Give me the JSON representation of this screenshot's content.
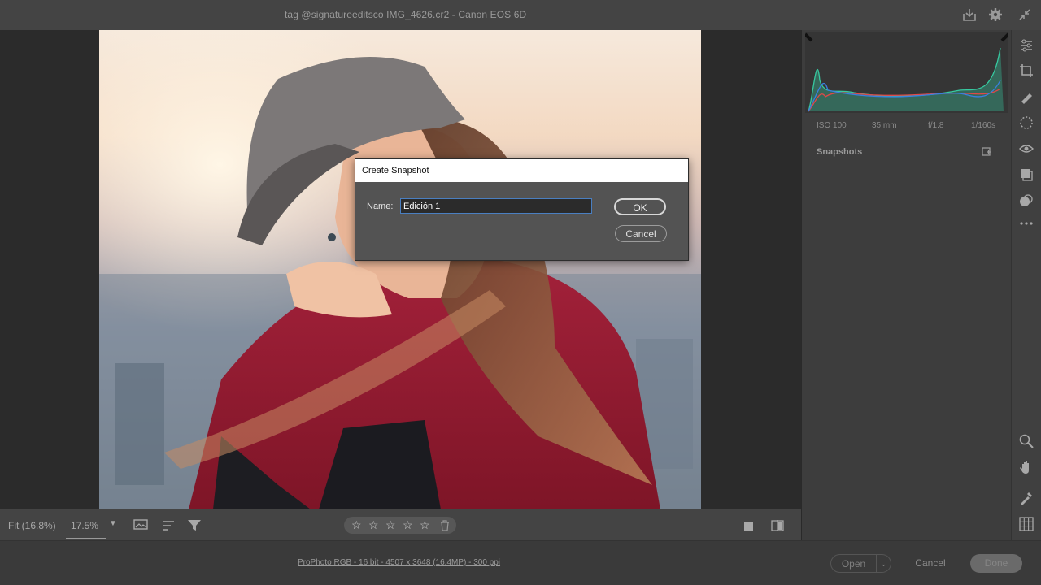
{
  "window": {
    "title": "tag @signatureeditsco IMG_4626.cr2  -  Canon EOS 6D"
  },
  "histogram": {
    "exif": {
      "iso": "ISO 100",
      "focal": "35 mm",
      "aperture": "f/1.8",
      "shutter": "1/160s"
    }
  },
  "snapshots_panel": {
    "label": "Snapshots"
  },
  "dialog": {
    "title": "Create Snapshot",
    "name_label": "Name:",
    "name_value": "Edición 1",
    "ok_label": "OK",
    "cancel_label": "Cancel"
  },
  "bottom_bar": {
    "fit_label": "Fit (16.8%)",
    "zoom_value": "17.5%",
    "rating_stars": [
      "☆",
      "☆",
      "☆",
      "☆",
      "☆"
    ]
  },
  "footer": {
    "workflow_link": "ProPhoto RGB - 16 bit - 4507 x 3648 (16.4MP) - 300 ppi",
    "open_label": "Open",
    "cancel_label": "Cancel",
    "done_label": "Done"
  },
  "colors": {
    "accent_focus": "#4a7fc1",
    "histogram_red": "#e04848",
    "histogram_green": "#37c9a0",
    "histogram_blue": "#3a7fe0"
  }
}
